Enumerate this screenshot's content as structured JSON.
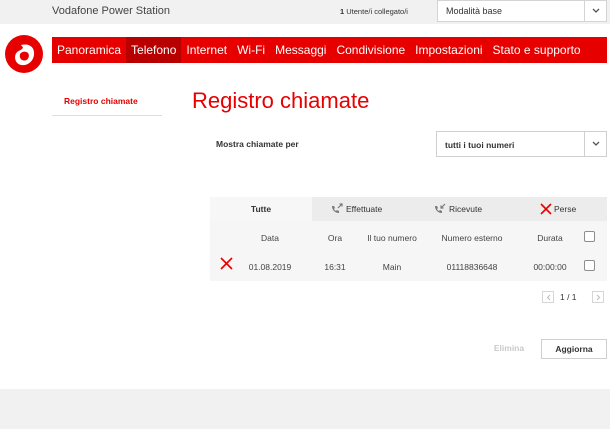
{
  "topbar": {
    "brand": "Vodafone Power Station",
    "users_count": "1",
    "users_label": "Utente/i collegato/i",
    "mode_select": {
      "value": "Modalità base"
    }
  },
  "nav": {
    "items": [
      {
        "label": "Panoramica"
      },
      {
        "label": "Telefono",
        "active": true
      },
      {
        "label": "Internet"
      },
      {
        "label": "Wi-Fi"
      },
      {
        "label": "Messaggi"
      },
      {
        "label": "Condivisione"
      },
      {
        "label": "Impostazioni"
      },
      {
        "label": "Stato e supporto"
      }
    ]
  },
  "sidebar": {
    "items": [
      {
        "label": "Registro chiamate"
      }
    ]
  },
  "page": {
    "title": "Registro chiamate",
    "filter_label": "Mostra chiamate per",
    "number_select": {
      "value": "tutti i tuoi numeri"
    }
  },
  "tabs": [
    {
      "label": "Tutte",
      "icon": "none"
    },
    {
      "label": "Effettuate",
      "icon": "outgoing-call-icon"
    },
    {
      "label": "Ricevute",
      "icon": "incoming-call-icon"
    },
    {
      "label": "Perse",
      "icon": "missed-call-icon"
    }
  ],
  "table": {
    "headers": {
      "date": "Data",
      "time": "Ora",
      "mine": "Il tuo numero",
      "external": "Numero esterno",
      "duration": "Durata"
    },
    "rows": [
      {
        "type": "missed",
        "date": "01.08.2019",
        "time": "16:31",
        "mine": "Main",
        "external": "01118836648",
        "duration": "00:00:00"
      }
    ]
  },
  "pager": {
    "text": "1 / 1"
  },
  "buttons": {
    "delete": "Elimina",
    "refresh": "Aggiorna"
  },
  "colors": {
    "brand_red": "#e60000",
    "active_tab_red": "#b80000",
    "disabled_text": "#c9c9c9"
  }
}
